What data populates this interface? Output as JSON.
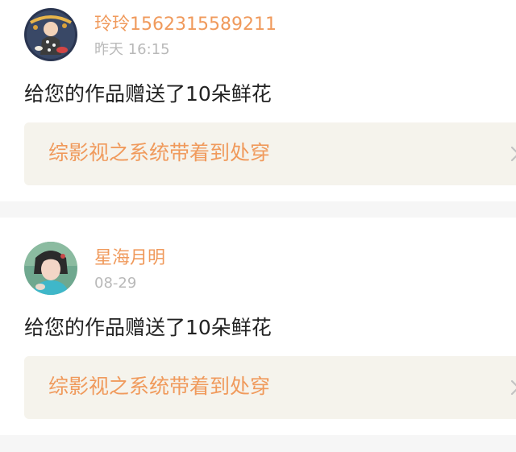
{
  "notifications": [
    {
      "username": "玲玲1562315589211",
      "time": "昨天 16:15",
      "message": "给您的作品赠送了10朵鲜花",
      "work_title": "综影视之系统带着到处穿",
      "avatar_icon": "baby-photo-avatar",
      "chevron_icon": "chevron-right-icon"
    },
    {
      "username": "星海月明",
      "time": "08-29",
      "message": "给您的作品赠送了10朵鲜花",
      "work_title": "综影视之系统带着到处穿",
      "avatar_icon": "character-photo-avatar",
      "chevron_icon": "chevron-right-icon"
    }
  ],
  "colors": {
    "accent": "#f09a5c",
    "muted_text": "#b9b9b9",
    "body_text": "#222222",
    "work_box_bg": "#f5f3ec",
    "page_bg": "#f6f6f6"
  }
}
